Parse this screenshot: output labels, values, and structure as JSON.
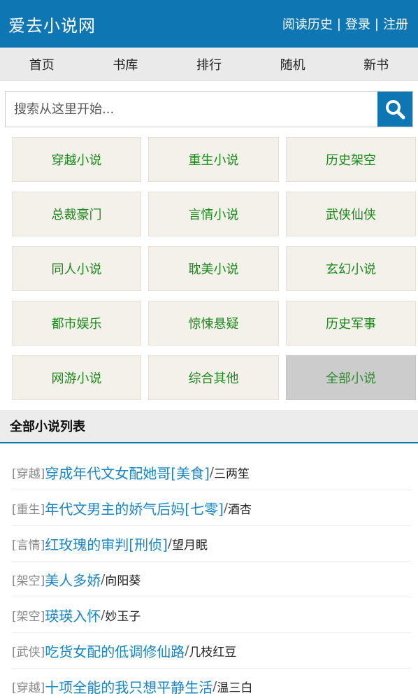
{
  "header": {
    "site_title": "爱去小说网",
    "history": "阅读历史",
    "login": "登录",
    "register": "注册",
    "separator": "|"
  },
  "nav": [
    "首页",
    "书库",
    "排行",
    "随机",
    "新书"
  ],
  "search": {
    "placeholder": "搜索从这里开始...",
    "icon": "search-icon"
  },
  "categories": [
    "穿越小说",
    "重生小说",
    "历史架空",
    "总裁豪门",
    "言情小说",
    "武侠仙侠",
    "同人小说",
    "耽美小说",
    "玄幻小说",
    "都市娱乐",
    "惊悚悬疑",
    "历史军事",
    "网游小说",
    "综合其他",
    "全部小说"
  ],
  "section_title": "全部小说列表",
  "books": [
    {
      "tag": "[穿越]",
      "title": "穿成年代文女配她哥[美食]",
      "author": "三两笙"
    },
    {
      "tag": "[重生]",
      "title": "年代文男主的娇气后妈[七零]",
      "author": "酒杏"
    },
    {
      "tag": "[言情]",
      "title": "红玫瑰的审判[刑侦]",
      "author": "望月眠"
    },
    {
      "tag": "[架空]",
      "title": "美人多娇",
      "author": "向阳葵"
    },
    {
      "tag": "[架空]",
      "title": "瑛瑛入怀",
      "author": "妙玉子"
    },
    {
      "tag": "[武侠]",
      "title": "吃货女配的低调修仙路",
      "author": "几枝红豆"
    },
    {
      "tag": "[穿越]",
      "title": "十项全能的我只想平静生活",
      "author": "温三白"
    }
  ],
  "colors": {
    "brand": "#0e77b3",
    "category_text": "#1a8a1a",
    "title_link": "#1a85c3"
  }
}
